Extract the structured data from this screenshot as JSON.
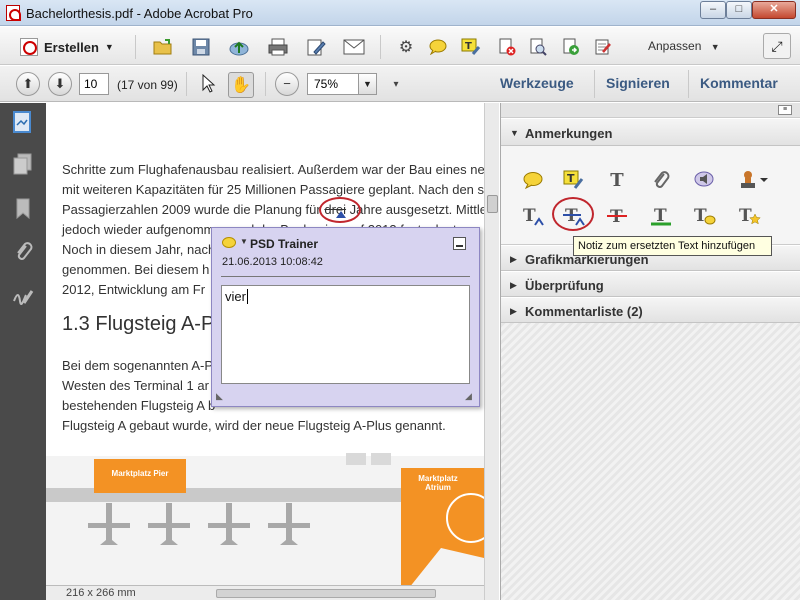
{
  "window": {
    "title": "Bachelorthesis.pdf - Adobe Acrobat Pro",
    "min": "–",
    "max": "□",
    "close": "✕"
  },
  "toolbar1": {
    "create_label": "Erstellen",
    "customize_label": "Anpassen"
  },
  "toolbar2": {
    "page_number": "10",
    "page_count": "(17 von 99)",
    "zoom": "75%"
  },
  "panels": {
    "tools": "Werkzeuge",
    "sign": "Signieren",
    "comment": "Kommentar"
  },
  "document": {
    "lines": [
      "Schritte zum Flughafenausbau realisiert. Außerdem war der Bau eines neue",
      "mit weiteren Kapazitäten für 25 Millionen Passagiere geplant. Nach den s",
      "Passagierzahlen 2009 wurde die Planung für",
      "jedoch wieder aufgenommen und der Baubeginn auf 2013 festgelegt.",
      "Noch in diesem Jahr, nach",
      "genommen. Bei diesem h",
      "2012, Entwicklung am Fr"
    ],
    "struck_word": "drei",
    "line3_tail": "Jahre ausgesetzt. Mittle",
    "heading": "1.3 Flugsteig A-P",
    "para2": [
      "Bei dem sogenannten A-P",
      "Westen des Terminal 1 ar",
      "bestehenden Flugsteig A b",
      "Flugsteig A gebaut wurde, wird der neue Flugsteig A-Plus genannt."
    ],
    "map_label_1": "Marktplatz Pier",
    "map_label_2": "Marktplatz Atrium",
    "page_size": "216 x 266 mm"
  },
  "note": {
    "author": "PSD Trainer",
    "date": "21.06.2013 10:08:42",
    "text": "vier"
  },
  "rightpanel": {
    "sections": [
      "Anmerkungen",
      "Grafikmarkierungen",
      "Überprüfung",
      "Kommentarliste (2)"
    ],
    "tooltip": "Notiz zum ersetzten Text hinzufügen"
  },
  "colors": {
    "accent": "#3b5a82",
    "note_bg": "#d7d3f0",
    "orange": "#f39224",
    "annotation_red": "#c0262d"
  }
}
